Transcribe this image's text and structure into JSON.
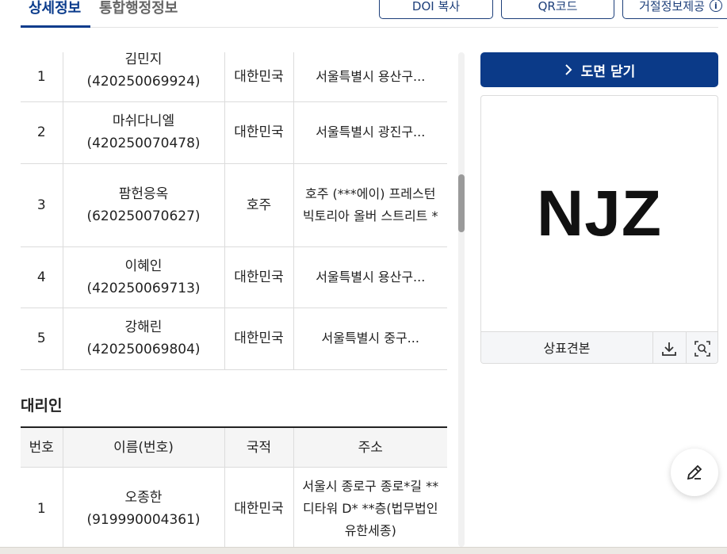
{
  "tabs": [
    {
      "label": "상세정보"
    },
    {
      "label": "통합행정정보"
    }
  ],
  "top_buttons": {
    "doi": "DOI 복사",
    "qr": "QR코드",
    "reject": "거절정보제공"
  },
  "applicants": [
    {
      "no": "1",
      "name": "김민지",
      "code": "(420250069924)",
      "country": "대한민국",
      "address": "서울특별시 용산구..."
    },
    {
      "no": "2",
      "name": "마쉬다니엘",
      "code": "(420250070478)",
      "country": "대한민국",
      "address": "서울특별시 광진구..."
    },
    {
      "no": "3",
      "name": "팜헌응옥",
      "code": "(620250070627)",
      "country": "호주",
      "address": "호주 (***에이) 프레스턴 빅토리아 올버 스트리트 *"
    },
    {
      "no": "4",
      "name": "이혜인",
      "code": "(420250069713)",
      "country": "대한민국",
      "address": "서울특별시 용산구..."
    },
    {
      "no": "5",
      "name": "강해린",
      "code": "(420250069804)",
      "country": "대한민국",
      "address": "서울특별시 중구..."
    }
  ],
  "agent_section": {
    "title": "대리인",
    "headers": [
      "번호",
      "이름(번호)",
      "국적",
      "주소"
    ],
    "rows": [
      {
        "no": "1",
        "name": "오종한",
        "code": "(919990004361)",
        "country": "대한민국",
        "address": "서울시 종로구 종로*길 ** 디타워 D* **층(법무법인유한세종)"
      }
    ]
  },
  "drawing": {
    "close_label": "도면 닫기",
    "mark_text": "NJZ",
    "caption": "상표견본"
  },
  "colors": {
    "primary": "#0b3a88",
    "tab_active": "#0b3c8c"
  }
}
